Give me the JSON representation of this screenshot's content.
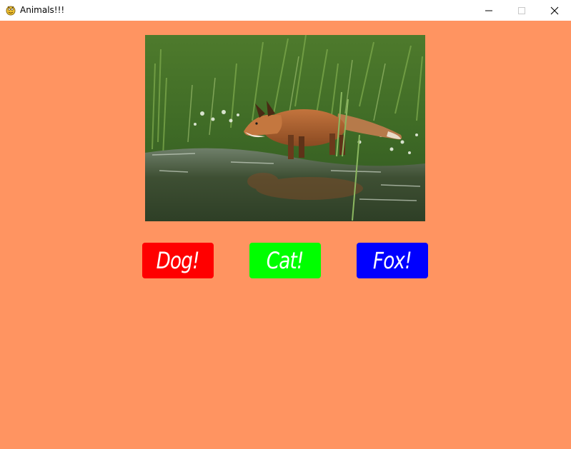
{
  "window": {
    "title": "Animals!!!",
    "icon": "pygame-snake-icon"
  },
  "photo": {
    "subject": "fox-photo"
  },
  "buttons": [
    {
      "label": "Dog!",
      "color": "#ff0000"
    },
    {
      "label": "Cat!",
      "color": "#00ff00"
    },
    {
      "label": "Fox!",
      "color": "#0000ff"
    }
  ],
  "colors": {
    "background": "#ff9461",
    "titlebar": "#ffffff"
  }
}
